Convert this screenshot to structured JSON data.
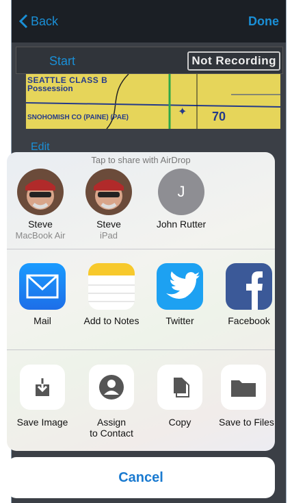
{
  "navbar": {
    "back_label": "Back",
    "done_label": "Done"
  },
  "app": {
    "start_label": "Start",
    "recording_status": "Not Recording",
    "edit_label": "Edit",
    "map_labels": [
      "SEATTLE CLASS B",
      "Possession",
      "SNOHOMISH CO (PAINE) (PAE)",
      "70"
    ]
  },
  "share_sheet": {
    "airdrop_hint": "Tap to share with AirDrop",
    "contacts": [
      {
        "name": "Steve",
        "device": "MacBook Air",
        "avatar": "photo-avatar"
      },
      {
        "name": "Steve",
        "device": "iPad",
        "avatar": "photo-avatar"
      },
      {
        "name": "John Rutter",
        "device": "",
        "initial": "J"
      }
    ],
    "apps": [
      {
        "label": "Mail",
        "icon": "mail-icon",
        "color": "#1d8ff1"
      },
      {
        "label": "Add to Notes",
        "icon": "notes-icon",
        "color": "#f7c92c"
      },
      {
        "label": "Twitter",
        "icon": "twitter-icon",
        "color": "#1da1f2"
      },
      {
        "label": "Facebook",
        "icon": "facebook-icon",
        "color": "#3b5998"
      }
    ],
    "actions": [
      {
        "label": "Save Image",
        "icon": "save-image-icon"
      },
      {
        "label": "Assign\nto Contact",
        "icon": "assign-contact-icon"
      },
      {
        "label": "Copy",
        "icon": "copy-icon"
      },
      {
        "label": "Save to Files",
        "icon": "folder-icon"
      }
    ],
    "cancel_label": "Cancel"
  },
  "colors": {
    "accent": "#1a8fd6",
    "cancel": "#1a7ad0"
  }
}
